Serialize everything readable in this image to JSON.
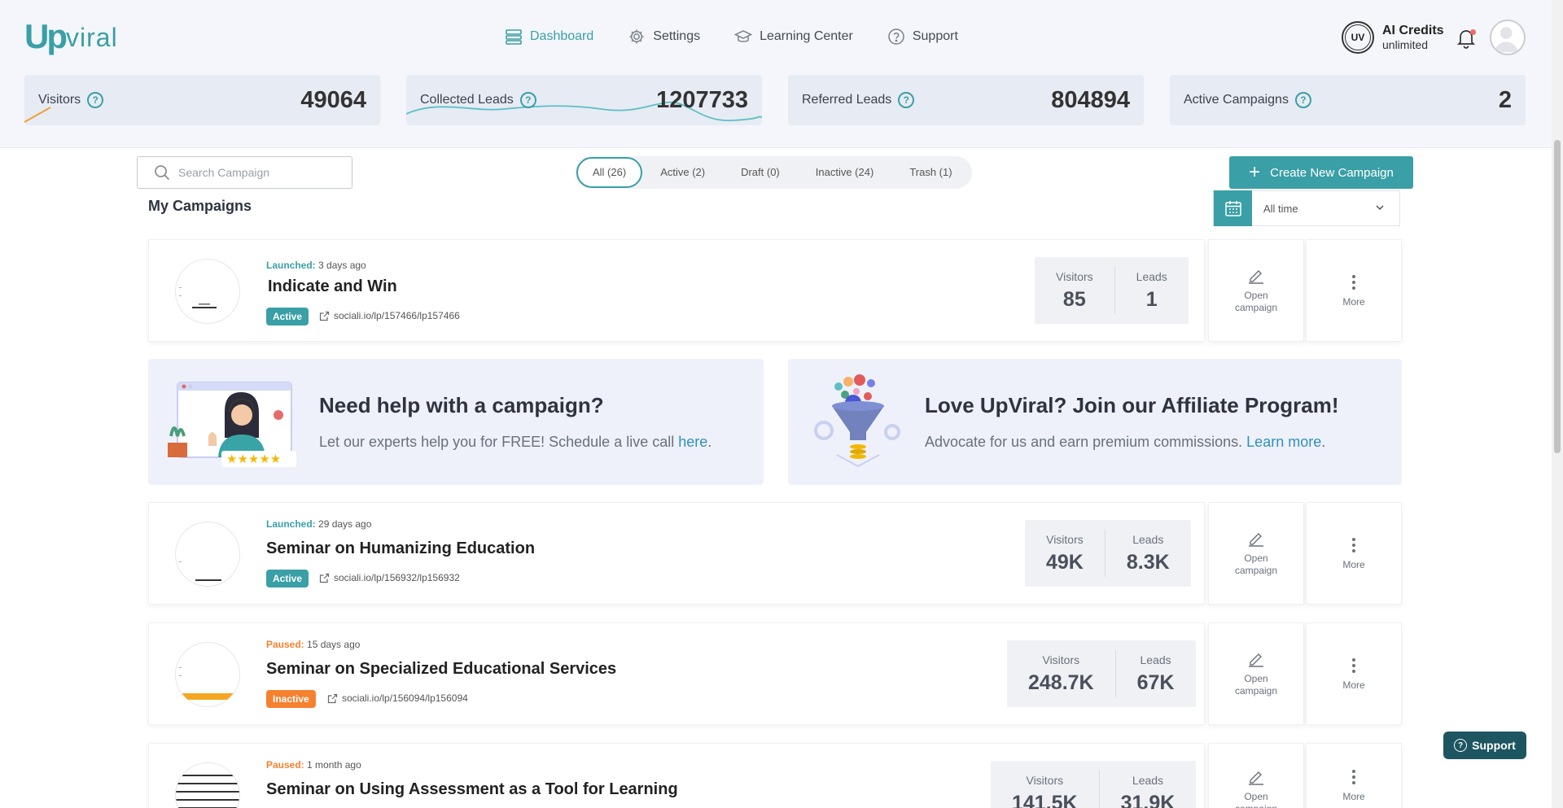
{
  "brand": {
    "logo_up": "Up",
    "logo_viral": "viral"
  },
  "nav": [
    {
      "label": "Dashboard",
      "icon": "dashboard-icon",
      "active": true
    },
    {
      "label": "Settings",
      "icon": "gear-icon"
    },
    {
      "label": "Learning Center",
      "icon": "graduation-cap-icon"
    },
    {
      "label": "Support",
      "icon": "question-circle-icon"
    }
  ],
  "account": {
    "badge": "UV",
    "credits_title": "AI Credits",
    "credits_value": "unlimited"
  },
  "stats": [
    {
      "label": "Visitors",
      "value": "49064"
    },
    {
      "label": "Collected Leads",
      "value": "1207733"
    },
    {
      "label": "Referred Leads",
      "value": "804894"
    },
    {
      "label": "Active Campaigns",
      "value": "2"
    }
  ],
  "toolbar": {
    "search_placeholder": "Search Campaign",
    "tabs": [
      "All (26)",
      "Active (2)",
      "Draft (0)",
      "Inactive (24)",
      "Trash (1)"
    ],
    "active_tab": "All (26)",
    "create_label": "Create New Campaign"
  },
  "section_title": "My Campaigns",
  "date_filter": {
    "value": "All time"
  },
  "campaigns": [
    {
      "status_label": "Launched:",
      "time": "3 days ago",
      "title": "Indicate and Win",
      "badge": "Active",
      "link": "sociali.io/lp/157466/lp157466",
      "visitors": "85",
      "leads": "1"
    },
    {
      "status_label": "Launched:",
      "time": "29 days ago",
      "title": "Seminar on Humanizing Education",
      "badge": "Active",
      "link": "sociali.io/lp/156932/lp156932",
      "visitors": "49K",
      "leads": "8.3K"
    },
    {
      "status_label": "Paused:",
      "time": "15 days ago",
      "title": "Seminar on Specialized Educational Services",
      "badge": "Inactive",
      "link": "sociali.io/lp/156094/lp156094",
      "visitors": "248.7K",
      "leads": "67K"
    },
    {
      "status_label": "Paused:",
      "time": "1 month ago",
      "title": "Seminar on Using Assessment as a Tool for Learning",
      "badge": "",
      "link": "",
      "visitors": "141.5K",
      "leads": "31.9K"
    }
  ],
  "metric_labels": {
    "visitors": "Visitors",
    "leads": "Leads"
  },
  "actions": {
    "open_line1": "Open",
    "open_line2": "campaign",
    "more": "More"
  },
  "promos": [
    {
      "title": "Need help with a campaign?",
      "text": "Let our experts help you for FREE! Schedule a live call ",
      "link": "here",
      "tail": "."
    },
    {
      "title": "Love UpViral? Join our Affiliate Program!",
      "text": "Advocate for us and earn premium commissions. ",
      "link": "Learn more",
      "tail": "."
    }
  ],
  "support_button": "Support",
  "colors": {
    "accent": "#3a9fa6",
    "paused": "#f5812f",
    "support_bg": "#1d5660",
    "link": "#2f8fbf"
  }
}
